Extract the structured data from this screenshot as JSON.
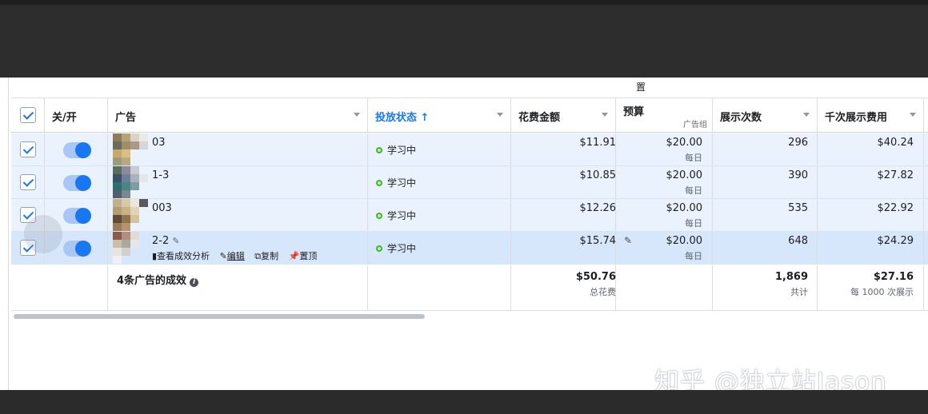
{
  "section_title": "置",
  "columns": {
    "toggle": "关/开",
    "ad": "广告",
    "status": "投放状态 ↑",
    "spend": "花费金额",
    "budget": "预算",
    "budget_sub": "广告组",
    "impressions": "展示次数",
    "cpm": "千次展示费用"
  },
  "rows": [
    {
      "name": "03",
      "status": "学习中",
      "spend": "$11.91",
      "budget": "$20.00",
      "budget_period": "每日",
      "impressions": "296",
      "cpm": "$40.24"
    },
    {
      "name": "1-3",
      "status": "学习中",
      "spend": "$10.85",
      "budget": "$20.00",
      "budget_period": "每日",
      "impressions": "390",
      "cpm": "$27.82"
    },
    {
      "name": "003",
      "status": "学习中",
      "spend": "$12.26",
      "budget": "$20.00",
      "budget_period": "每日",
      "impressions": "535",
      "cpm": "$22.92"
    },
    {
      "name": "2-2",
      "status": "学习中",
      "spend": "$15.74",
      "budget": "$20.00",
      "budget_period": "每日",
      "impressions": "648",
      "cpm": "$24.29"
    }
  ],
  "row_actions": {
    "insights": "查看成效分析",
    "edit": "编辑",
    "duplicate": "复制",
    "pin": "置顶"
  },
  "totals": {
    "label": "4条广告的成效",
    "spend": "$50.76",
    "spend_sub": "总花费",
    "impressions": "1,869",
    "impressions_sub": "共计",
    "cpm": "$27.16",
    "cpm_sub": "每 1000 次展示"
  },
  "watermark": "知乎 @独立站Jason",
  "colors": {
    "accent": "#1877f2",
    "row_bg": "#eaf2fd",
    "selected_row_bg": "#d6e6fb",
    "status_green": "#42b72a"
  }
}
